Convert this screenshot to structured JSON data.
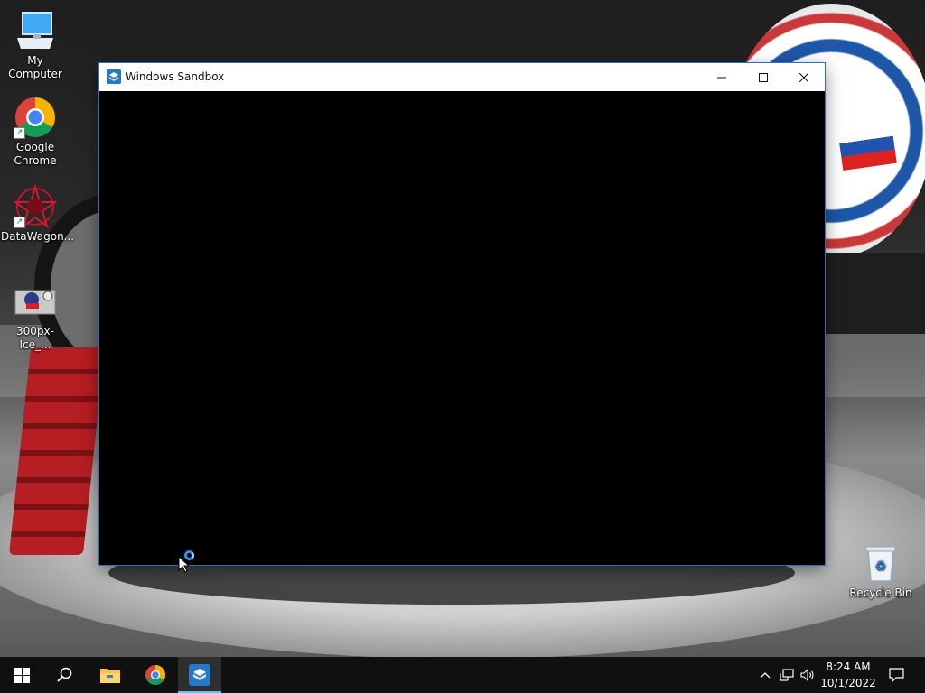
{
  "desktop": {
    "icons": [
      {
        "label": "My Computer"
      },
      {
        "label": "Google Chrome"
      },
      {
        "label": "DataWagon..."
      },
      {
        "label": "300px-Ice_..."
      },
      {
        "label": "Recycle Bin"
      }
    ]
  },
  "window": {
    "title": "Windows Sandbox",
    "buttons": {
      "minimize": "minimize-icon",
      "maximize": "maximize-icon",
      "close": "close-icon"
    }
  },
  "taskbar": {
    "items": [
      "start-icon",
      "search-icon",
      "file-explorer-icon",
      "chrome-icon",
      "windows-sandbox-icon"
    ],
    "active": "windows-sandbox-icon",
    "tray": [
      "chevron-up-icon",
      "network-icon",
      "volume-icon",
      "notification-icon"
    ],
    "clock": {
      "time": "8:24 AM",
      "date": "10/1/2022"
    }
  },
  "colors": {
    "accent": "#76b9ed",
    "taskbar": "#101010",
    "window_border": "#2a6fc0"
  }
}
